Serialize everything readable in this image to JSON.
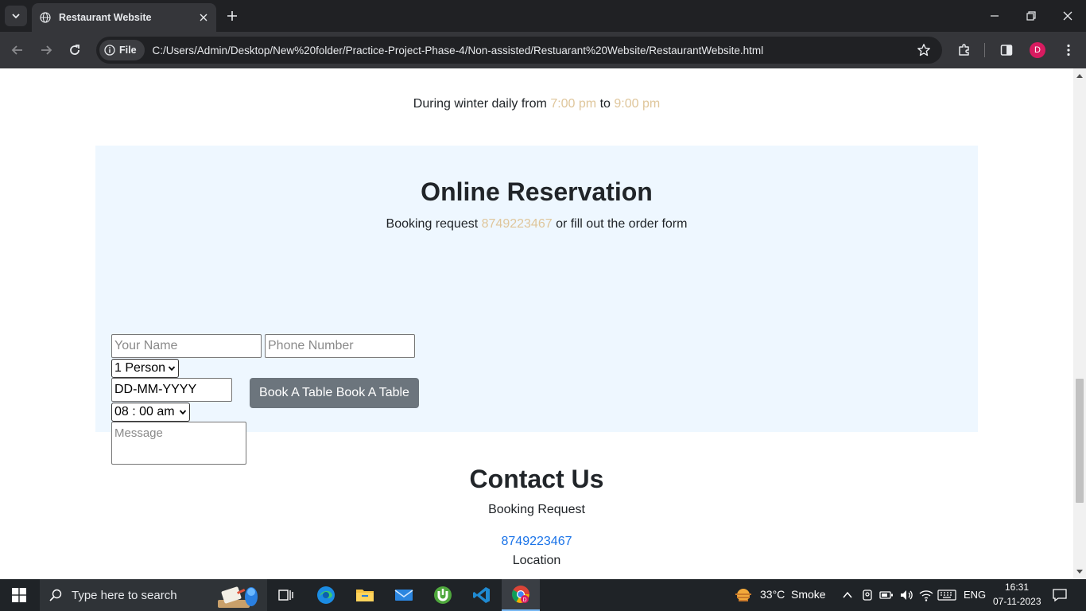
{
  "browser": {
    "tab_title": "Restaurant Website",
    "site_chip": "File",
    "url": "C:/Users/Admin/Desktop/New%20folder/Practice-Project-Phase-4/Non-assisted/Restuarant%20Website/RestaurantWebsite.html",
    "profile_initial": "D"
  },
  "hours": {
    "prefix": "During winter daily from",
    "start": "7:00 pm",
    "joiner": "to",
    "end": "9:00 pm"
  },
  "reservation": {
    "title": "Online Reservation",
    "subtitle_prefix": "Booking request",
    "phone": "8749223467",
    "subtitle_suffix": "or fill out the order form",
    "name_placeholder": "Your Name",
    "phone_placeholder": "Phone Number",
    "persons_selected": "1 Person",
    "date_placeholder": "DD-MM-YYYY",
    "time_selected": "08 : 00 am",
    "message_placeholder": "Message",
    "book_button": "Book A Table Book A Table"
  },
  "contact": {
    "title": "Contact Us",
    "booking_label": "Booking Request",
    "phone": "8749223467",
    "location_label": "Location"
  },
  "taskbar": {
    "search_placeholder": "Type here to search",
    "weather_temp": "33°C",
    "weather_desc": "Smoke",
    "language": "ENG",
    "time": "16:31",
    "date": "07-11-2023"
  },
  "colors": {
    "accent_gold": "#dfc69b",
    "reservation_bg": "#eef7ff",
    "button_gray": "#6c757d",
    "link_blue": "#1a73e8"
  }
}
